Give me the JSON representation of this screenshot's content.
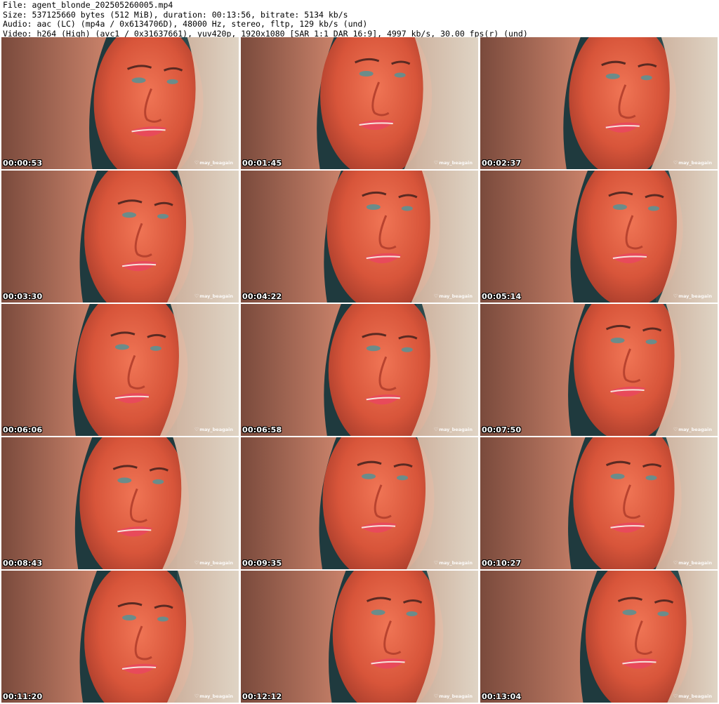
{
  "header": {
    "file_line": "File: agent_blonde_202505260005.mp4",
    "size_line": "Size: 537125660 bytes (512 MiB), duration: 00:13:56, bitrate: 5134 kb/s",
    "audio_line": "Audio: aac (LC) (mp4a / 0x6134706D), 48000 Hz, stereo, fltp, 129 kb/s (und)",
    "video_line": "Video: h264 (High) (avc1 / 0x31637661), yuv420p, 1920x1080 [SAR 1:1 DAR 16:9], 4997 kb/s, 30.00 fps(r) (und)"
  },
  "watermark": "may_beagain",
  "colors": {
    "background": "#1f3a3e",
    "skin": "#e2603f",
    "hair": "#c98a6a",
    "lips": "#e84a5a"
  },
  "thumbnails": [
    {
      "timestamp": "00:00:53"
    },
    {
      "timestamp": "00:01:45"
    },
    {
      "timestamp": "00:02:37"
    },
    {
      "timestamp": "00:03:30"
    },
    {
      "timestamp": "00:04:22"
    },
    {
      "timestamp": "00:05:14"
    },
    {
      "timestamp": "00:06:06"
    },
    {
      "timestamp": "00:06:58"
    },
    {
      "timestamp": "00:07:50"
    },
    {
      "timestamp": "00:08:43"
    },
    {
      "timestamp": "00:09:35"
    },
    {
      "timestamp": "00:10:27"
    },
    {
      "timestamp": "00:11:20"
    },
    {
      "timestamp": "00:12:12"
    },
    {
      "timestamp": "00:13:04"
    }
  ]
}
